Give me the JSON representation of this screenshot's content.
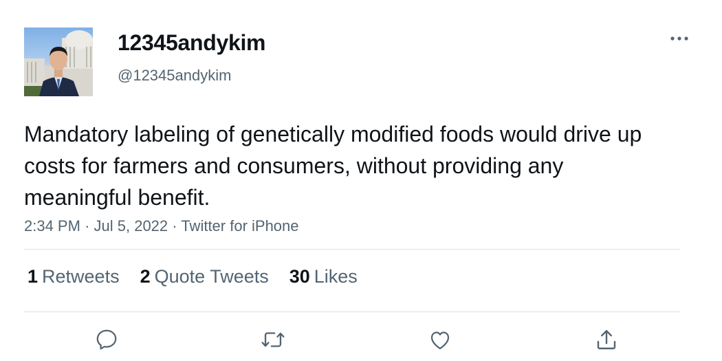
{
  "author": {
    "display_name": "12345andykim",
    "handle": "@12345andykim",
    "avatar_icon": "profile-photo"
  },
  "tweet": {
    "text": "Mandatory labeling of genetically modified foods would drive up costs for farmers and consumers, without providing any meaningful benefit.",
    "time": "2:34 PM",
    "date": "Jul 5, 2022",
    "source": "Twitter for iPhone",
    "separator": "·"
  },
  "stats": {
    "retweets_count": "1",
    "retweets_label": "Retweets",
    "quote_tweets_count": "2",
    "quote_tweets_label": "Quote Tweets",
    "likes_count": "30",
    "likes_label": "Likes"
  },
  "actions": {
    "icons": [
      "reply-icon",
      "retweet-icon",
      "like-icon",
      "share-icon"
    ],
    "menu_icon": "more-icon"
  },
  "colors": {
    "text": "#0f1419",
    "secondary": "#536471",
    "divider": "#dcdfe2"
  }
}
